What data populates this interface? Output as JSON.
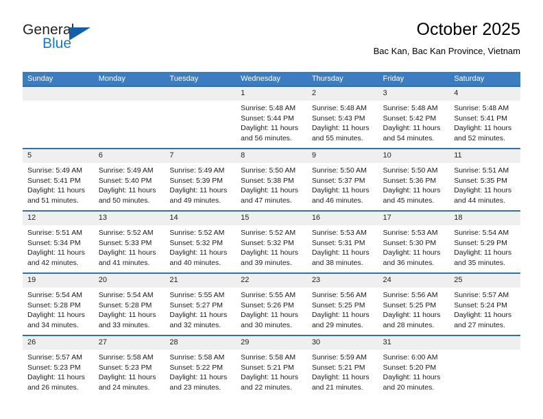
{
  "brand": {
    "name_part1": "General",
    "name_part2": "Blue",
    "accent_color": "#1b77c4",
    "triangle_color": "#1360a8"
  },
  "header": {
    "title": "October 2025",
    "subtitle": "Bac Kan, Bac Kan Province, Vietnam"
  },
  "calendar": {
    "header_bg": "#3b7dc0",
    "row_border_color": "#2f6fb0",
    "daynum_bg": "#efefef",
    "weekday_headers": [
      "Sunday",
      "Monday",
      "Tuesday",
      "Wednesday",
      "Thursday",
      "Friday",
      "Saturday"
    ],
    "weeks": [
      [
        {
          "day": "",
          "empty": true,
          "sunrise": "",
          "sunset": "",
          "daylight_line1": "",
          "daylight_line2": ""
        },
        {
          "day": "",
          "empty": true,
          "sunrise": "",
          "sunset": "",
          "daylight_line1": "",
          "daylight_line2": ""
        },
        {
          "day": "",
          "empty": true,
          "sunrise": "",
          "sunset": "",
          "daylight_line1": "",
          "daylight_line2": ""
        },
        {
          "day": "1",
          "empty": false,
          "sunrise": "Sunrise: 5:48 AM",
          "sunset": "Sunset: 5:44 PM",
          "daylight_line1": "Daylight: 11 hours",
          "daylight_line2": "and 56 minutes."
        },
        {
          "day": "2",
          "empty": false,
          "sunrise": "Sunrise: 5:48 AM",
          "sunset": "Sunset: 5:43 PM",
          "daylight_line1": "Daylight: 11 hours",
          "daylight_line2": "and 55 minutes."
        },
        {
          "day": "3",
          "empty": false,
          "sunrise": "Sunrise: 5:48 AM",
          "sunset": "Sunset: 5:42 PM",
          "daylight_line1": "Daylight: 11 hours",
          "daylight_line2": "and 54 minutes."
        },
        {
          "day": "4",
          "empty": false,
          "sunrise": "Sunrise: 5:48 AM",
          "sunset": "Sunset: 5:41 PM",
          "daylight_line1": "Daylight: 11 hours",
          "daylight_line2": "and 52 minutes."
        }
      ],
      [
        {
          "day": "5",
          "empty": false,
          "sunrise": "Sunrise: 5:49 AM",
          "sunset": "Sunset: 5:41 PM",
          "daylight_line1": "Daylight: 11 hours",
          "daylight_line2": "and 51 minutes."
        },
        {
          "day": "6",
          "empty": false,
          "sunrise": "Sunrise: 5:49 AM",
          "sunset": "Sunset: 5:40 PM",
          "daylight_line1": "Daylight: 11 hours",
          "daylight_line2": "and 50 minutes."
        },
        {
          "day": "7",
          "empty": false,
          "sunrise": "Sunrise: 5:49 AM",
          "sunset": "Sunset: 5:39 PM",
          "daylight_line1": "Daylight: 11 hours",
          "daylight_line2": "and 49 minutes."
        },
        {
          "day": "8",
          "empty": false,
          "sunrise": "Sunrise: 5:50 AM",
          "sunset": "Sunset: 5:38 PM",
          "daylight_line1": "Daylight: 11 hours",
          "daylight_line2": "and 47 minutes."
        },
        {
          "day": "9",
          "empty": false,
          "sunrise": "Sunrise: 5:50 AM",
          "sunset": "Sunset: 5:37 PM",
          "daylight_line1": "Daylight: 11 hours",
          "daylight_line2": "and 46 minutes."
        },
        {
          "day": "10",
          "empty": false,
          "sunrise": "Sunrise: 5:50 AM",
          "sunset": "Sunset: 5:36 PM",
          "daylight_line1": "Daylight: 11 hours",
          "daylight_line2": "and 45 minutes."
        },
        {
          "day": "11",
          "empty": false,
          "sunrise": "Sunrise: 5:51 AM",
          "sunset": "Sunset: 5:35 PM",
          "daylight_line1": "Daylight: 11 hours",
          "daylight_line2": "and 44 minutes."
        }
      ],
      [
        {
          "day": "12",
          "empty": false,
          "sunrise": "Sunrise: 5:51 AM",
          "sunset": "Sunset: 5:34 PM",
          "daylight_line1": "Daylight: 11 hours",
          "daylight_line2": "and 42 minutes."
        },
        {
          "day": "13",
          "empty": false,
          "sunrise": "Sunrise: 5:52 AM",
          "sunset": "Sunset: 5:33 PM",
          "daylight_line1": "Daylight: 11 hours",
          "daylight_line2": "and 41 minutes."
        },
        {
          "day": "14",
          "empty": false,
          "sunrise": "Sunrise: 5:52 AM",
          "sunset": "Sunset: 5:32 PM",
          "daylight_line1": "Daylight: 11 hours",
          "daylight_line2": "and 40 minutes."
        },
        {
          "day": "15",
          "empty": false,
          "sunrise": "Sunrise: 5:52 AM",
          "sunset": "Sunset: 5:32 PM",
          "daylight_line1": "Daylight: 11 hours",
          "daylight_line2": "and 39 minutes."
        },
        {
          "day": "16",
          "empty": false,
          "sunrise": "Sunrise: 5:53 AM",
          "sunset": "Sunset: 5:31 PM",
          "daylight_line1": "Daylight: 11 hours",
          "daylight_line2": "and 38 minutes."
        },
        {
          "day": "17",
          "empty": false,
          "sunrise": "Sunrise: 5:53 AM",
          "sunset": "Sunset: 5:30 PM",
          "daylight_line1": "Daylight: 11 hours",
          "daylight_line2": "and 36 minutes."
        },
        {
          "day": "18",
          "empty": false,
          "sunrise": "Sunrise: 5:54 AM",
          "sunset": "Sunset: 5:29 PM",
          "daylight_line1": "Daylight: 11 hours",
          "daylight_line2": "and 35 minutes."
        }
      ],
      [
        {
          "day": "19",
          "empty": false,
          "sunrise": "Sunrise: 5:54 AM",
          "sunset": "Sunset: 5:28 PM",
          "daylight_line1": "Daylight: 11 hours",
          "daylight_line2": "and 34 minutes."
        },
        {
          "day": "20",
          "empty": false,
          "sunrise": "Sunrise: 5:54 AM",
          "sunset": "Sunset: 5:28 PM",
          "daylight_line1": "Daylight: 11 hours",
          "daylight_line2": "and 33 minutes."
        },
        {
          "day": "21",
          "empty": false,
          "sunrise": "Sunrise: 5:55 AM",
          "sunset": "Sunset: 5:27 PM",
          "daylight_line1": "Daylight: 11 hours",
          "daylight_line2": "and 32 minutes."
        },
        {
          "day": "22",
          "empty": false,
          "sunrise": "Sunrise: 5:55 AM",
          "sunset": "Sunset: 5:26 PM",
          "daylight_line1": "Daylight: 11 hours",
          "daylight_line2": "and 30 minutes."
        },
        {
          "day": "23",
          "empty": false,
          "sunrise": "Sunrise: 5:56 AM",
          "sunset": "Sunset: 5:25 PM",
          "daylight_line1": "Daylight: 11 hours",
          "daylight_line2": "and 29 minutes."
        },
        {
          "day": "24",
          "empty": false,
          "sunrise": "Sunrise: 5:56 AM",
          "sunset": "Sunset: 5:25 PM",
          "daylight_line1": "Daylight: 11 hours",
          "daylight_line2": "and 28 minutes."
        },
        {
          "day": "25",
          "empty": false,
          "sunrise": "Sunrise: 5:57 AM",
          "sunset": "Sunset: 5:24 PM",
          "daylight_line1": "Daylight: 11 hours",
          "daylight_line2": "and 27 minutes."
        }
      ],
      [
        {
          "day": "26",
          "empty": false,
          "sunrise": "Sunrise: 5:57 AM",
          "sunset": "Sunset: 5:23 PM",
          "daylight_line1": "Daylight: 11 hours",
          "daylight_line2": "and 26 minutes."
        },
        {
          "day": "27",
          "empty": false,
          "sunrise": "Sunrise: 5:58 AM",
          "sunset": "Sunset: 5:23 PM",
          "daylight_line1": "Daylight: 11 hours",
          "daylight_line2": "and 24 minutes."
        },
        {
          "day": "28",
          "empty": false,
          "sunrise": "Sunrise: 5:58 AM",
          "sunset": "Sunset: 5:22 PM",
          "daylight_line1": "Daylight: 11 hours",
          "daylight_line2": "and 23 minutes."
        },
        {
          "day": "29",
          "empty": false,
          "sunrise": "Sunrise: 5:58 AM",
          "sunset": "Sunset: 5:21 PM",
          "daylight_line1": "Daylight: 11 hours",
          "daylight_line2": "and 22 minutes."
        },
        {
          "day": "30",
          "empty": false,
          "sunrise": "Sunrise: 5:59 AM",
          "sunset": "Sunset: 5:21 PM",
          "daylight_line1": "Daylight: 11 hours",
          "daylight_line2": "and 21 minutes."
        },
        {
          "day": "31",
          "empty": false,
          "sunrise": "Sunrise: 6:00 AM",
          "sunset": "Sunset: 5:20 PM",
          "daylight_line1": "Daylight: 11 hours",
          "daylight_line2": "and 20 minutes."
        },
        {
          "day": "",
          "empty": true,
          "sunrise": "",
          "sunset": "",
          "daylight_line1": "",
          "daylight_line2": ""
        }
      ]
    ]
  }
}
